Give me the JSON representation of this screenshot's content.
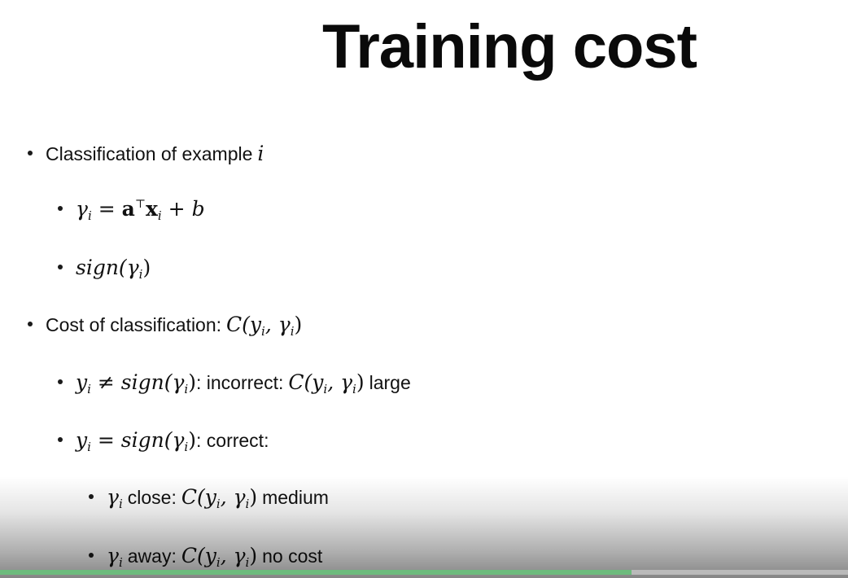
{
  "slide": {
    "title": "Training cost"
  },
  "bullets": {
    "b1_text": "Classification of example",
    "b1_var": "i",
    "b2_gamma": "γ",
    "b2_i": "i",
    "b2_eq": "=",
    "b2_a": "a",
    "b2_T": "⊤",
    "b2_x": "x",
    "b2_i2": "i",
    "b2_plus": "+",
    "b2_b": "b",
    "b3_sign": "sign(",
    "b3_gamma": "γ",
    "b3_i": "i",
    "b3_close": ")",
    "b4_text": "Cost of classification:",
    "b4_C": "C(y",
    "b4_i": "i",
    "b4_comma": ", γ",
    "b4_i2": "i",
    "b4_close": ")",
    "b5_y": "y",
    "b5_i": "i",
    "b5_neq": "≠",
    "b5_sign": "sign(γ",
    "b5_i2": "i",
    "b5_close": ")",
    "b5_text1": ": incorrect:",
    "b5_C": "C(y",
    "b5_i3": "i",
    "b5_comma": ", γ",
    "b5_i4": "i",
    "b5_close2": ")",
    "b5_text2": "large",
    "b6_y": "y",
    "b6_i": "i",
    "b6_eq": "=",
    "b6_sign": "sign(γ",
    "b6_i2": "i",
    "b6_close": ")",
    "b6_text": ": correct:",
    "b7_gamma": "γ",
    "b7_i": "i",
    "b7_text1": "close:",
    "b7_C": "C(y",
    "b7_i2": "i",
    "b7_comma": ", γ",
    "b7_i3": "i",
    "b7_close": ")",
    "b7_text2": "medium",
    "b8_gamma": "γ",
    "b8_i": "i",
    "b8_text1": "away:",
    "b8_C": "C(y",
    "b8_i2": "i",
    "b8_comma": ", γ",
    "b8_i3": "i",
    "b8_close": ")",
    "b8_text2": "no cost"
  },
  "player": {
    "progress_fraction": 0.745,
    "progress_color": "#6dbb7d"
  }
}
